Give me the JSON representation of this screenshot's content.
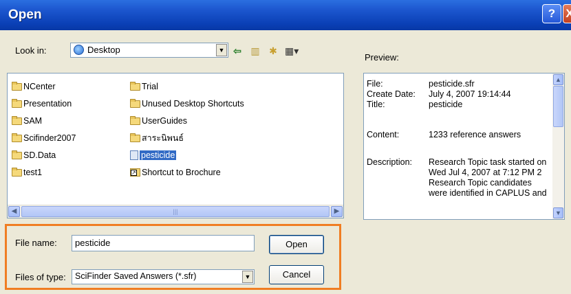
{
  "window": {
    "title": "Open",
    "help_label": "?",
    "close_label": "X"
  },
  "lookin": {
    "label": "Look in:",
    "value": "Desktop",
    "icon": "desktop-icon"
  },
  "toolbar": {
    "icons": [
      "back-icon",
      "up-folder-icon",
      "new-folder-icon",
      "views-menu-icon"
    ]
  },
  "files": {
    "col1": [
      {
        "name": "NCenter",
        "type": "folder"
      },
      {
        "name": "Presentation",
        "type": "folder"
      },
      {
        "name": "SAM",
        "type": "folder"
      },
      {
        "name": "Scifinder2007",
        "type": "folder"
      },
      {
        "name": "SD.Data",
        "type": "folder"
      },
      {
        "name": "test1",
        "type": "folder"
      }
    ],
    "col2": [
      {
        "name": "Trial",
        "type": "folder"
      },
      {
        "name": "Unused Desktop Shortcuts",
        "type": "folder"
      },
      {
        "name": "UserGuides",
        "type": "folder"
      },
      {
        "name": "สาระนิพนธ์",
        "type": "folder"
      },
      {
        "name": "pesticide",
        "type": "file",
        "selected": true
      },
      {
        "name": "Shortcut to Brochure",
        "type": "shortcut"
      }
    ]
  },
  "preview": {
    "label": "Preview:",
    "fields": [
      {
        "key": "File:",
        "value": "pesticide.sfr"
      },
      {
        "key": "Create Date:",
        "value": "July 4, 2007 19:14:44"
      },
      {
        "key": "Title:",
        "value": "pesticide"
      },
      {
        "key": "Content:",
        "value": "1233 reference answers"
      },
      {
        "key": "Description:",
        "value": "Research Topic task started on Wed Jul 4, 2007 at 7:12 PM 2 Research Topic candidates were identified in CAPLUS and"
      }
    ]
  },
  "filename": {
    "label": "File name:",
    "value": "pesticide"
  },
  "filetype": {
    "label": "Files of type:",
    "value": "SciFinder Saved Answers (*.sfr)"
  },
  "buttons": {
    "open": "Open",
    "cancel": "Cancel"
  },
  "colors": {
    "titlebar": "#0a3fb5",
    "highlight": "#f07d22",
    "selection": "#316ac5"
  }
}
